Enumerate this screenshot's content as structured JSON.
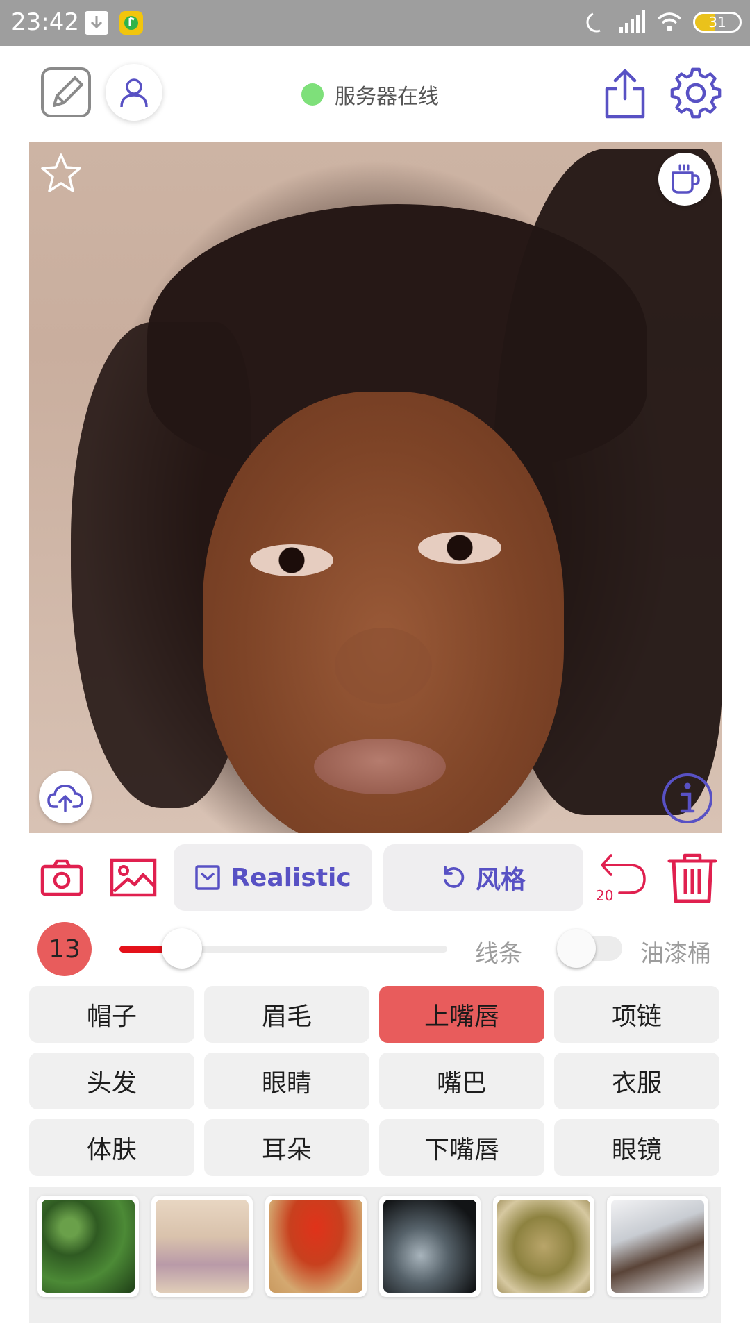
{
  "status_bar": {
    "time": "23:42",
    "battery": "31"
  },
  "toolbar": {
    "server_status": "服务器在线"
  },
  "actions": {
    "model_label": "Realistic",
    "style_label": "风格",
    "undo_count": "20"
  },
  "slider": {
    "brush_size": "13",
    "line_label": "线条",
    "bucket_label": "油漆桶",
    "value_fraction": 0.19,
    "bucket_toggle_on": false
  },
  "categories": [
    {
      "label": "帽子",
      "selected": false
    },
    {
      "label": "眉毛",
      "selected": false
    },
    {
      "label": "上嘴唇",
      "selected": true
    },
    {
      "label": "项链",
      "selected": false
    },
    {
      "label": "头发",
      "selected": false
    },
    {
      "label": "眼睛",
      "selected": false
    },
    {
      "label": "嘴巴",
      "selected": false
    },
    {
      "label": "衣服",
      "selected": false
    },
    {
      "label": "体肤",
      "selected": false
    },
    {
      "label": "耳朵",
      "selected": false
    },
    {
      "label": "下嘴唇",
      "selected": false
    },
    {
      "label": "眼镜",
      "selected": false
    }
  ],
  "colors": {
    "accent_purple": "#5851c4",
    "accent_pink": "#e0204f",
    "selected_red": "#e85c5c",
    "server_online": "#7ee07a"
  },
  "style_thumbnails": [
    "green-foliage",
    "pale-lace",
    "red-tree",
    "dark-smoke",
    "olive-texture",
    "snowy-bark"
  ]
}
